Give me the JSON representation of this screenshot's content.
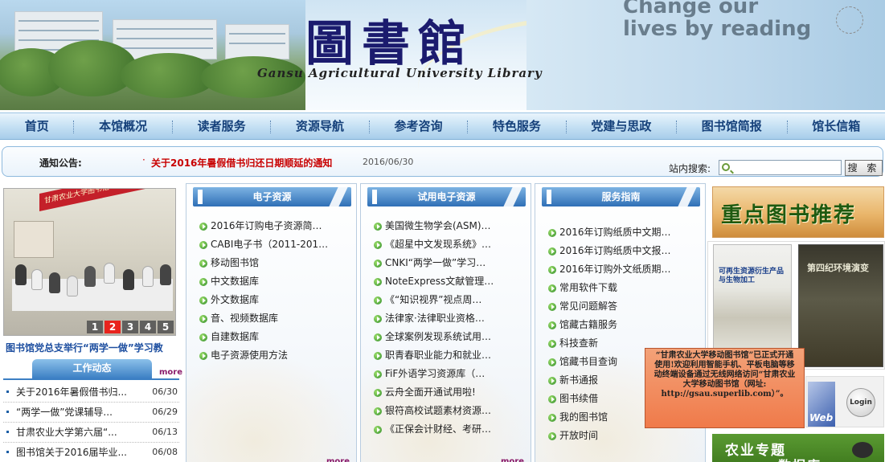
{
  "header": {
    "logo_title": "圖書館",
    "logo_subtitle": "Gansu Agricultural University Library",
    "slogan_line1": "Change our",
    "slogan_line2": "lives by reading"
  },
  "nav": {
    "items": [
      {
        "label": "首页"
      },
      {
        "label": "本馆概况"
      },
      {
        "label": "读者服务"
      },
      {
        "label": "资源导航"
      },
      {
        "label": "参考咨询"
      },
      {
        "label": "特色服务"
      },
      {
        "label": "党建与思政"
      },
      {
        "label": "图书馆简报"
      },
      {
        "label": "馆长信箱"
      }
    ]
  },
  "notice": {
    "label": "通知公告:",
    "bullet": "·",
    "title": "关于2016年暑假借书归还日期顺延的通知",
    "date": "2016/06/30",
    "search_label": "站内搜索:",
    "search_value": "",
    "search_button": "搜 索"
  },
  "slideshow": {
    "banner_text": "甘肃农业大学图书馆",
    "caption": "图书馆党总支举行“两学一做”学习教",
    "pages": [
      "1",
      "2",
      "3",
      "4",
      "5"
    ],
    "active_page": "2"
  },
  "work": {
    "tab": "工作动态",
    "more": "more",
    "items": [
      {
        "title": "关于2016年暑假借书归...",
        "date": "06/30"
      },
      {
        "title": "“两学一做”党课辅导...",
        "date": "06/29"
      },
      {
        "title": "甘肃农业大学第六届“...",
        "date": "06/13"
      },
      {
        "title": "图书馆关于2016届毕业...",
        "date": "06/08"
      }
    ]
  },
  "columns": {
    "e_resources": {
      "title": "电子资源",
      "more": "more",
      "items": [
        "2016年订购电子资源简…",
        "CABI电子书（2011-201…",
        "移动图书馆",
        "中文数据库",
        "外文数据库",
        "音、视频数据库",
        "自建数据库",
        "电子资源使用方法"
      ]
    },
    "trial": {
      "title": "试用电子资源",
      "more": "more",
      "items": [
        "美国微生物学会(ASM)…",
        "《超星中文发现系统》…",
        "CNKI“两学一做”学习…",
        "NoteExpress文献管理…",
        "《“知识视界”视点周…",
        "法律家·法律职业资格…",
        "全球案例发现系统试用…",
        "职青春职业能力和就业…",
        "FiF外语学习资源库（…",
        "云舟全面开通试用啦!",
        "银符高校试题素材资源…",
        "《正保会计财经、考研…"
      ]
    },
    "service": {
      "title": "服务指南",
      "items": [
        "2016年订购纸质中文期…",
        "2016年订购纸质中文报…",
        "2016年订购外文纸质期…",
        "常用软件下载",
        "常见问题解答",
        "馆藏古籍服务",
        "科技查新",
        "馆藏书目查询",
        "新书通报",
        "图书续借",
        "我的图书馆",
        "开放时间"
      ]
    }
  },
  "right": {
    "recommend_title": "重点图书推荐",
    "book1_title": "可再生资源衍生产品与生物加工",
    "book2_title": "第四纪环境演变",
    "popup_text": "“甘肃农业大学移动图书馆”已正式开通使用!欢迎利用智能手机、平板电脑等移动终端设备通过无线网络访问“甘肃农业大学移动图书馆（网址:",
    "popup_url": "http://gsau.superlib.com）”。",
    "login_label": "Login",
    "web_label": "Web",
    "agri_line1": "农业专题",
    "agri_line2": "数据库"
  }
}
